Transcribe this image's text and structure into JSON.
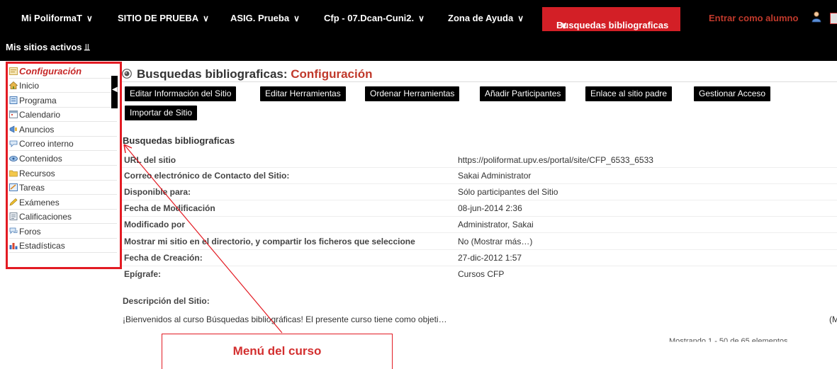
{
  "topnav": {
    "items": [
      "Mi PoliformaT",
      "SITIO DE PRUEBA",
      "ASIG. Prueba",
      "Cfp - 07.Dcan-Cuni2.",
      "Zona de Ayuda"
    ],
    "active": "Busquedas bibliograficas",
    "student_link": "Entrar como alumno",
    "my_sites": "Mis sitios activos",
    "chevron": "∨",
    "double_chevron": "⫫"
  },
  "sidebar": {
    "items": [
      {
        "label": "Configuración",
        "icon": "settings-icon",
        "active": true
      },
      {
        "label": "Inicio",
        "icon": "home-icon"
      },
      {
        "label": "Programa",
        "icon": "syllabus-icon"
      },
      {
        "label": "Calendario",
        "icon": "calendar-icon"
      },
      {
        "label": "Anuncios",
        "icon": "announcements-icon"
      },
      {
        "label": "Correo interno",
        "icon": "mail-icon"
      },
      {
        "label": "Contenidos",
        "icon": "content-icon"
      },
      {
        "label": "Recursos",
        "icon": "folder-icon"
      },
      {
        "label": "Tareas",
        "icon": "assignments-icon"
      },
      {
        "label": "Exámenes",
        "icon": "pencil-icon"
      },
      {
        "label": "Calificaciones",
        "icon": "gradebook-icon"
      },
      {
        "label": "Foros",
        "icon": "forums-icon"
      },
      {
        "label": "Estadísticas",
        "icon": "stats-icon"
      }
    ],
    "toggle": "◀"
  },
  "page": {
    "title_prefix": "Busquedas bibliograficas: ",
    "title_highlight": "Configuración"
  },
  "toolbar": {
    "buttons": [
      "Editar Información del Sitio",
      "Editar Herramientas",
      "Ordenar Herramientas",
      "Añadir Participantes",
      "Enlace al sitio padre",
      "Gestionar Acceso",
      "Importar de Sitio"
    ]
  },
  "site": {
    "name": "Busquedas bibliograficas",
    "properties": [
      {
        "label": "URL del sitio",
        "value": "https://poliformat.upv.es/portal/site/CFP_6533_6533"
      },
      {
        "label": "Correo electrónico de Contacto del Sitio:",
        "value": "Sakai Administrator"
      },
      {
        "label": "Disponible para:",
        "value": "Sólo participantes del Sitio"
      },
      {
        "label": "Fecha de Modificación",
        "value": "08-jun-2014 2:36"
      },
      {
        "label": "Modificado por",
        "value": "Administrator, Sakai"
      },
      {
        "label": "Mostrar mi sitio en el directorio, y compartir los ficheros que seleccione",
        "value": "No (Mostrar más…)"
      },
      {
        "label": "Fecha de Creación:",
        "value": "27-dic-2012 1:57"
      },
      {
        "label": "Epígrafe:",
        "value": "Cursos CFP"
      }
    ],
    "description_label": "Descripción del Sitio:",
    "description": "¡Bienvenidos al curso Búsquedas bibliográficas!   El presente curso tiene como objeti…",
    "description_more": "(M",
    "showing": "Mostrando 1 - 50 de 65 elementos"
  },
  "callout": {
    "text": "Menú del curso"
  },
  "colors": {
    "accent": "#d31f26",
    "topbar": "#000000"
  }
}
